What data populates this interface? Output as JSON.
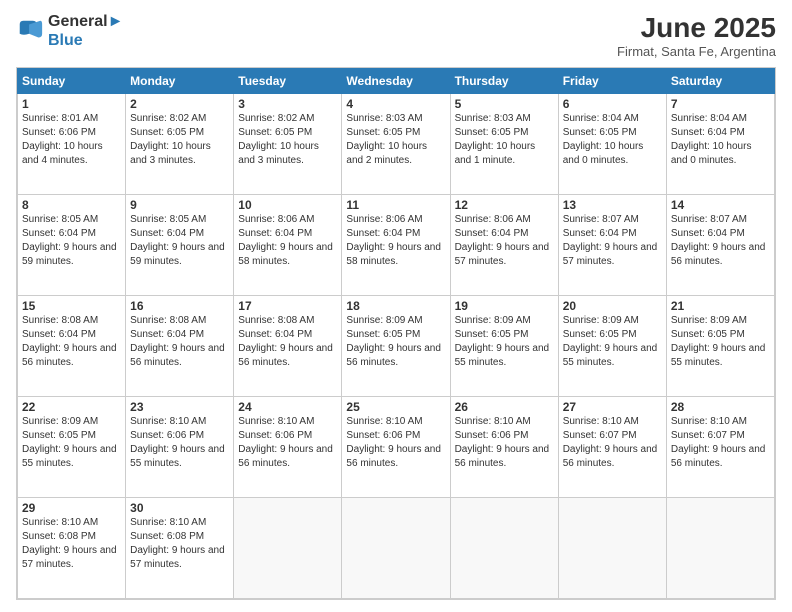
{
  "logo": {
    "line1": "General",
    "line2": "Blue"
  },
  "title": "June 2025",
  "subtitle": "Firmat, Santa Fe, Argentina",
  "days": [
    "Sunday",
    "Monday",
    "Tuesday",
    "Wednesday",
    "Thursday",
    "Friday",
    "Saturday"
  ],
  "weeks": [
    [
      {
        "num": "1",
        "sunrise": "8:01 AM",
        "sunset": "6:06 PM",
        "daylight": "10 hours and 4 minutes."
      },
      {
        "num": "2",
        "sunrise": "8:02 AM",
        "sunset": "6:05 PM",
        "daylight": "10 hours and 3 minutes."
      },
      {
        "num": "3",
        "sunrise": "8:02 AM",
        "sunset": "6:05 PM",
        "daylight": "10 hours and 3 minutes."
      },
      {
        "num": "4",
        "sunrise": "8:03 AM",
        "sunset": "6:05 PM",
        "daylight": "10 hours and 2 minutes."
      },
      {
        "num": "5",
        "sunrise": "8:03 AM",
        "sunset": "6:05 PM",
        "daylight": "10 hours and 1 minute."
      },
      {
        "num": "6",
        "sunrise": "8:04 AM",
        "sunset": "6:05 PM",
        "daylight": "10 hours and 0 minutes."
      },
      {
        "num": "7",
        "sunrise": "8:04 AM",
        "sunset": "6:04 PM",
        "daylight": "10 hours and 0 minutes."
      }
    ],
    [
      {
        "num": "8",
        "sunrise": "8:05 AM",
        "sunset": "6:04 PM",
        "daylight": "9 hours and 59 minutes."
      },
      {
        "num": "9",
        "sunrise": "8:05 AM",
        "sunset": "6:04 PM",
        "daylight": "9 hours and 59 minutes."
      },
      {
        "num": "10",
        "sunrise": "8:06 AM",
        "sunset": "6:04 PM",
        "daylight": "9 hours and 58 minutes."
      },
      {
        "num": "11",
        "sunrise": "8:06 AM",
        "sunset": "6:04 PM",
        "daylight": "9 hours and 58 minutes."
      },
      {
        "num": "12",
        "sunrise": "8:06 AM",
        "sunset": "6:04 PM",
        "daylight": "9 hours and 57 minutes."
      },
      {
        "num": "13",
        "sunrise": "8:07 AM",
        "sunset": "6:04 PM",
        "daylight": "9 hours and 57 minutes."
      },
      {
        "num": "14",
        "sunrise": "8:07 AM",
        "sunset": "6:04 PM",
        "daylight": "9 hours and 56 minutes."
      }
    ],
    [
      {
        "num": "15",
        "sunrise": "8:08 AM",
        "sunset": "6:04 PM",
        "daylight": "9 hours and 56 minutes."
      },
      {
        "num": "16",
        "sunrise": "8:08 AM",
        "sunset": "6:04 PM",
        "daylight": "9 hours and 56 minutes."
      },
      {
        "num": "17",
        "sunrise": "8:08 AM",
        "sunset": "6:04 PM",
        "daylight": "9 hours and 56 minutes."
      },
      {
        "num": "18",
        "sunrise": "8:09 AM",
        "sunset": "6:05 PM",
        "daylight": "9 hours and 56 minutes."
      },
      {
        "num": "19",
        "sunrise": "8:09 AM",
        "sunset": "6:05 PM",
        "daylight": "9 hours and 55 minutes."
      },
      {
        "num": "20",
        "sunrise": "8:09 AM",
        "sunset": "6:05 PM",
        "daylight": "9 hours and 55 minutes."
      },
      {
        "num": "21",
        "sunrise": "8:09 AM",
        "sunset": "6:05 PM",
        "daylight": "9 hours and 55 minutes."
      }
    ],
    [
      {
        "num": "22",
        "sunrise": "8:09 AM",
        "sunset": "6:05 PM",
        "daylight": "9 hours and 55 minutes."
      },
      {
        "num": "23",
        "sunrise": "8:10 AM",
        "sunset": "6:06 PM",
        "daylight": "9 hours and 55 minutes."
      },
      {
        "num": "24",
        "sunrise": "8:10 AM",
        "sunset": "6:06 PM",
        "daylight": "9 hours and 56 minutes."
      },
      {
        "num": "25",
        "sunrise": "8:10 AM",
        "sunset": "6:06 PM",
        "daylight": "9 hours and 56 minutes."
      },
      {
        "num": "26",
        "sunrise": "8:10 AM",
        "sunset": "6:06 PM",
        "daylight": "9 hours and 56 minutes."
      },
      {
        "num": "27",
        "sunrise": "8:10 AM",
        "sunset": "6:07 PM",
        "daylight": "9 hours and 56 minutes."
      },
      {
        "num": "28",
        "sunrise": "8:10 AM",
        "sunset": "6:07 PM",
        "daylight": "9 hours and 56 minutes."
      }
    ],
    [
      {
        "num": "29",
        "sunrise": "8:10 AM",
        "sunset": "6:08 PM",
        "daylight": "9 hours and 57 minutes."
      },
      {
        "num": "30",
        "sunrise": "8:10 AM",
        "sunset": "6:08 PM",
        "daylight": "9 hours and 57 minutes."
      },
      null,
      null,
      null,
      null,
      null
    ]
  ]
}
